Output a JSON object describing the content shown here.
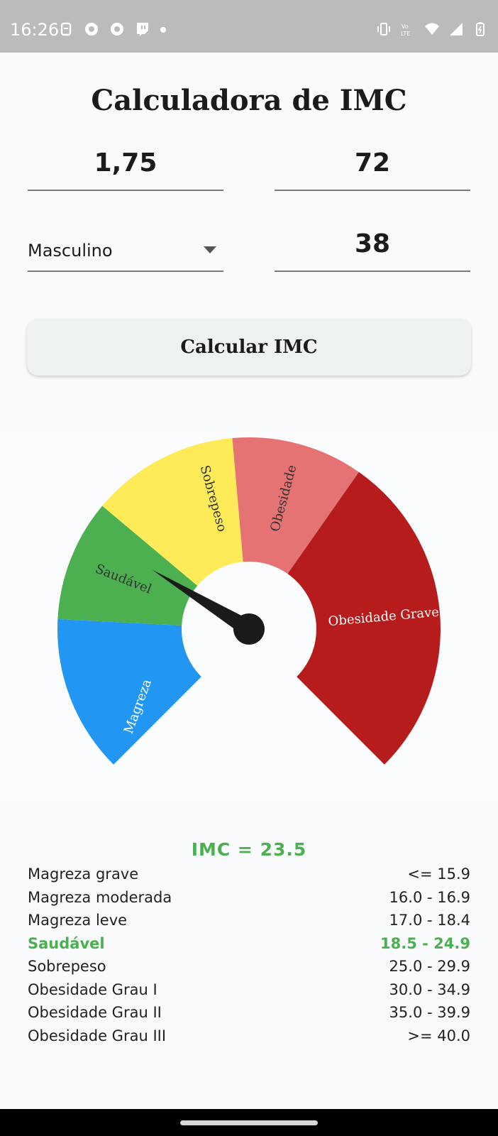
{
  "status": {
    "time": "16:26"
  },
  "title": "Calculadora de IMC",
  "inputs": {
    "height": "1,75",
    "weight": "72",
    "sex": "Masculino",
    "age": "38"
  },
  "button": {
    "label": "Calcular IMC"
  },
  "gauge": {
    "segments": [
      {
        "label": "Magreza",
        "color": "#2196f3"
      },
      {
        "label": "Saudável",
        "color": "#4caf50"
      },
      {
        "label": "Sobrepeso",
        "color": "#ffeb57"
      },
      {
        "label": "Obesidade",
        "color": "#e57373"
      },
      {
        "label": "Obesidade Grave",
        "color": "#b71c1c"
      }
    ],
    "needle_value": 23.5
  },
  "result": {
    "text": "IMC = 23.5",
    "color": "#4caf50"
  },
  "table": [
    {
      "label": "Magreza grave",
      "range": "<= 15.9"
    },
    {
      "label": "Magreza moderada",
      "range": "16.0 - 16.9"
    },
    {
      "label": "Magreza leve",
      "range": "17.0 - 18.4"
    },
    {
      "label": "Saudável",
      "range": "18.5 - 24.9",
      "active": true
    },
    {
      "label": "Sobrepeso",
      "range": "25.0 - 29.9"
    },
    {
      "label": "Obesidade Grau I",
      "range": "30.0 - 34.9"
    },
    {
      "label": "Obesidade Grau II",
      "range": "35.0 - 39.9"
    },
    {
      "label": "Obesidade Grau III",
      "range": ">= 40.0"
    }
  ]
}
